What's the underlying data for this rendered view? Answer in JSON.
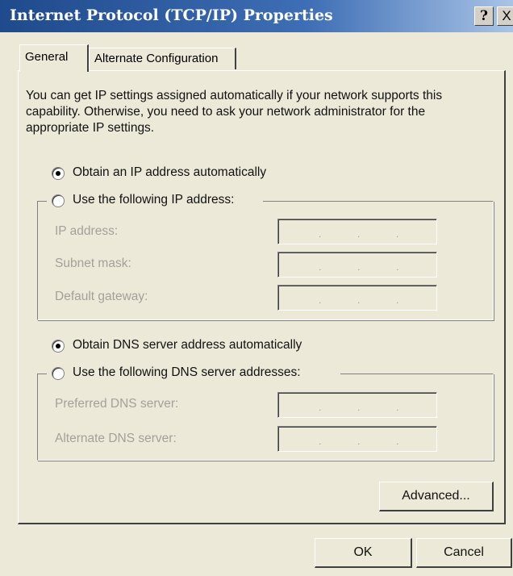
{
  "window": {
    "title": "Internet Protocol (TCP/IP) Properties",
    "help_button": "?",
    "close_button": "X"
  },
  "tabs": [
    {
      "label": "General",
      "selected": true
    },
    {
      "label": "Alternate Configuration",
      "selected": false
    }
  ],
  "description": "You can get IP settings assigned automatically if your network supports this capability. Otherwise, you need to ask your network administrator for the appropriate IP settings.",
  "ip_section": {
    "auto_option": "Obtain an IP address automatically",
    "manual_option": "Use the following IP address:",
    "selected": "auto",
    "fields": [
      {
        "label": "IP address:",
        "value": ". . ."
      },
      {
        "label": "Subnet mask:",
        "value": ". . ."
      },
      {
        "label": "Default gateway:",
        "value": ". . ."
      }
    ]
  },
  "dns_section": {
    "auto_option": "Obtain DNS server address automatically",
    "manual_option": "Use the following DNS server addresses:",
    "selected": "auto",
    "fields": [
      {
        "label": "Preferred DNS server:",
        "value": ". . ."
      },
      {
        "label": "Alternate DNS server:",
        "value": ". . ."
      }
    ]
  },
  "buttons": {
    "advanced": "Advanced...",
    "ok": "OK",
    "cancel": "Cancel"
  }
}
